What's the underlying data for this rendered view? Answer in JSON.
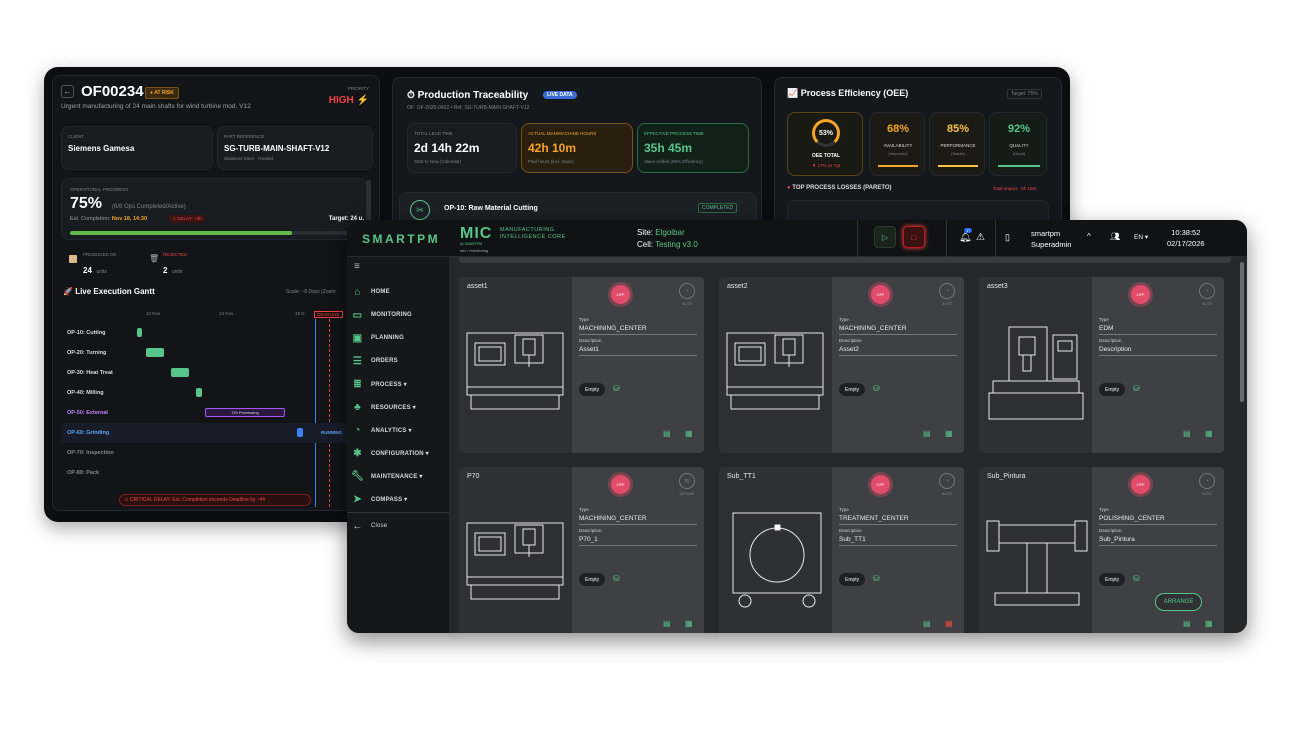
{
  "win1": {
    "order": {
      "id": "OF00234",
      "badge": "● AT RISK",
      "subtitle": "Urgent manufacturing of 24 main shafts for wind turbine mod. V12",
      "priority_label": "PRIORITY",
      "priority_value": "HIGH ⚡",
      "client_label": "CLIENT",
      "client_value": "Siemens Gamesa",
      "part_label": "PART REFERENCE",
      "part_value": "SG-TURB-MAIN-SHAFT-V12",
      "part_sub": "Stainless Steel - Treated",
      "progress_label": "OPERATIONAL PROGRESS",
      "progress_value": "75%",
      "progress_fraction": 0.75,
      "progress_ops": "(6/8 Ops Completed/Active)",
      "est_label": "Est. Completion:",
      "est_value": "Nov 18, 14:30",
      "delay": "⚠ DELAY: +4h",
      "target": "Target: 24 u.",
      "produced_label": "PRODUCED OK",
      "produced_value": "24",
      "produced_unit": "units",
      "rejected_label": "REJECTED",
      "rejected_value": "2",
      "rejected_unit": "units"
    },
    "gantt": {
      "title": "Live Execution Gantt",
      "scale": "Scale: ~8 Days (Zoom",
      "dates": [
        "10 Nov",
        "13 Nov",
        "15 N"
      ],
      "deadline": "DEADLINE",
      "rows": [
        {
          "label": "OP-10: Cutting",
          "start": 0.0,
          "end": 0.03
        },
        {
          "label": "OP-20: Turning",
          "start": 0.05,
          "end": 0.15
        },
        {
          "label": "OP-30: Heat Treat",
          "start": 0.19,
          "end": 0.29
        },
        {
          "label": "OP-40: Milling",
          "start": 0.33,
          "end": 0.36
        },
        {
          "label": "OP-50: External",
          "start": 0.38,
          "end": 0.82
        },
        {
          "label": "OP-60: Grinding",
          "start": 0.89,
          "end": 0.92
        },
        {
          "label": "OP-70: Inspection",
          "start": 0,
          "end": 0
        },
        {
          "label": "OP-80: Pack",
          "start": 0,
          "end": 0
        }
      ],
      "external_bar_label": "72h Processing",
      "running": "RUNNING",
      "critical": "⚠ CRITICAL DELAY: Est. Completion exceeds Deadline by ~4h"
    },
    "trace": {
      "title": "Production Traceability",
      "live": "LIVE DATA",
      "ref": "OF: OF-2025-0402 • Ref: SG-TURB-MAIN-SHAFT-V12",
      "lead_label": "TOTAL LEAD TIME",
      "lead_value": "2d 14h 22m",
      "lead_sub": "Start to Now (Calendar)",
      "actual_label": "ACTUAL MAN/MACHINE HOURS",
      "actual_value": "42h 10m",
      "actual_sub": "Paid hours (incl. stops)",
      "effective_label": "EFFECTIVE PROCESS TIME",
      "effective_value": "35h 45m",
      "effective_sub": "Value Added (85% Efficiency)",
      "op_title": "OP-10: Raw Material Cutting",
      "op_status": "COMPLETED"
    },
    "oee": {
      "title": "Process Efficiency (OEE)",
      "target": "Target: 75%",
      "total_value": "53%",
      "total_fraction": 0.53,
      "total_label": "OEE TOTAL",
      "total_delta": "▼ 17% vs Tgt",
      "availability_value": "68%",
      "availability_label": "AVAILABILITY",
      "availability_sub": "(Improved)",
      "performance_value": "85%",
      "performance_label": "PERFORMANCE",
      "performance_sub": "(Stable)",
      "quality_value": "92%",
      "quality_label": "QUALITY",
      "quality_sub": "(Good)",
      "losses_title": "TOP PROCESS LOSSES (PARETO)",
      "losses_total": "Total Impact: -3h 15m"
    }
  },
  "win2": {
    "brand": "SMARTPM",
    "mic": "MIC",
    "mic_line1": "MANUFACTURING",
    "mic_line2": "INTELLIGENCE CORE",
    "mic_by": "by SMARTPM",
    "breadcrumb": "mic / monitoring",
    "site_label": "Site:",
    "site_value": "Elgoibar",
    "cell_label": "Cell:",
    "cell_value": "Testing v3.0",
    "notif_count": "17",
    "user_name": "smartpm",
    "user_role": "Superadmin",
    "lang": "EN",
    "time": "10:38:52",
    "date": "02/17/2026",
    "nav": [
      {
        "label": "HOME",
        "icon": "home-icon"
      },
      {
        "label": "MONITORING",
        "icon": "monitor-icon"
      },
      {
        "label": "PLANNING",
        "icon": "calendar-icon"
      },
      {
        "label": "ORDERS",
        "icon": "list-icon"
      },
      {
        "label": "PROCESS ▾",
        "icon": "process-icon"
      },
      {
        "label": "RESOURCES ▾",
        "icon": "resources-icon"
      },
      {
        "label": "ANALYTICS ▾",
        "icon": "analytics-icon"
      },
      {
        "label": "CONFIGURATION ▾",
        "icon": "gear-icon"
      },
      {
        "label": "MAINTENANCE ▾",
        "icon": "wrench-icon"
      },
      {
        "label": "COMPASS ▾",
        "icon": "compass-icon"
      }
    ],
    "close": "Close",
    "off": "OFF",
    "auto": "AUTO",
    "offline": "OFFLINE",
    "type_label": "Type",
    "desc_label": "Description",
    "empty": "Empty",
    "arrange": "ARRANGE",
    "assets": [
      {
        "name": "asset1",
        "type": "MACHINING_CENTER",
        "desc": "Asset1",
        "status": "AUTO"
      },
      {
        "name": "asset2",
        "type": "MACHINING_CENTER",
        "desc": "Asset2",
        "status": "AUTO"
      },
      {
        "name": "asset3",
        "type": "EDM",
        "desc": "Description",
        "status": "AUTO"
      },
      {
        "name": "P70",
        "type": "MACHINING_CENTER",
        "desc": "P70_1",
        "status": "OFFLINE"
      },
      {
        "name": "Sub_TT1",
        "type": "TREATMENT_CENTER",
        "desc": "Sub_TT1",
        "status": "AUTO"
      },
      {
        "name": "Sub_Pintura",
        "type": "POLISHING_CENTER",
        "desc": "Sub_Pintura",
        "status": "AUTO"
      }
    ]
  }
}
